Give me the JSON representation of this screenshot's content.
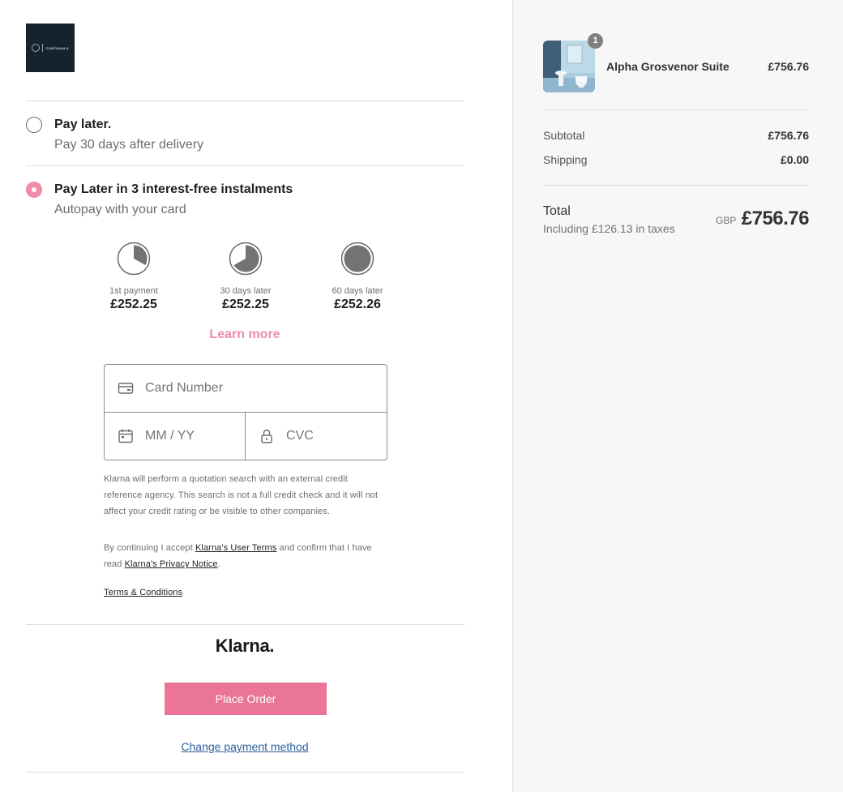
{
  "store": {
    "logo_text": "CONTINUALS"
  },
  "payment_options": [
    {
      "title": "Pay later.",
      "subtitle": "Pay 30 days after delivery",
      "selected": false
    },
    {
      "title": "Pay Later in 3 interest-free instalments",
      "subtitle": "Autopay with your card",
      "selected": true
    }
  ],
  "instalments": [
    {
      "label": "1st payment",
      "amount": "£252.25",
      "progress": 0.33
    },
    {
      "label": "30 days later",
      "amount": "£252.25",
      "progress": 0.67
    },
    {
      "label": "60 days later",
      "amount": "£252.26",
      "progress": 1.0
    }
  ],
  "learn_more": "Learn more",
  "card_form": {
    "card_number_placeholder": "Card Number",
    "expiry_placeholder": "MM / YY",
    "cvc_placeholder": "CVC"
  },
  "legal": {
    "quotation": "Klarna will perform a quotation search with an external credit reference agency. This search is not a full credit check and it will not affect your credit rating or be visible to other companies.",
    "accept_prefix": "By continuing I accept ",
    "user_terms_link": "Klarna's User Terms",
    "accept_middle": " and confirm that I have read ",
    "privacy_link": "Klarna's Privacy Notice",
    "accept_suffix": ".",
    "terms_link": "Terms & Conditions"
  },
  "klarna_logo": "Klarna.",
  "place_order": "Place Order",
  "change_method": "Change payment method",
  "summary": {
    "product": {
      "name": "Alpha Grosvenor Suite",
      "price": "£756.76",
      "quantity": "1"
    },
    "subtotal_label": "Subtotal",
    "subtotal_value": "£756.76",
    "shipping_label": "Shipping",
    "shipping_value": "£0.00",
    "total_label": "Total",
    "taxes_note": "Including £126.13 in taxes",
    "currency": "GBP",
    "total_value": "£756.76"
  },
  "colors": {
    "klarna_pink": "#f08ba8",
    "place_order_bg": "#ea7597",
    "link_blue": "#2d5f9a",
    "logo_bg": "#14232c",
    "sidebar_bg": "#f7f7f7"
  }
}
